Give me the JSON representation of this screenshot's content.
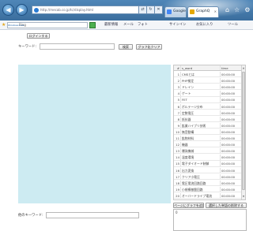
{
  "browser": {
    "address": "http://mecab.co.jp/tc/display.html",
    "tabs": [
      {
        "label": "Google"
      },
      {
        "label": "GraphQ"
      }
    ],
    "favbar": {
      "live_search_label": "Windows Live",
      "live_search_value": "Bing",
      "links": [
        "最新情報",
        "メール",
        "フォト",
        "サインイン",
        "お気に入り",
        "ツール"
      ],
      "favorites_label": "お気に入り"
    }
  },
  "page": {
    "top_button": "ログインする",
    "keyword_label": "キーワード:",
    "keyword_value": "",
    "search_button": "検索",
    "graph_button": "グラフ化クリア",
    "bottom_keyword_label": "他のキーワード:",
    "bottom_keyword_value": "",
    "add_button": "ページにグラフを追加",
    "remove_button": "選択した単語の削除する",
    "textarea_value": "0"
  },
  "table": {
    "headers": [
      "#",
      "s_word",
      "time"
    ],
    "rows": [
      {
        "no": "1",
        "word": "CMSとは",
        "time": "00:00:00"
      },
      {
        "no": "2",
        "word": "PHP検定",
        "time": "00:00:00"
      },
      {
        "no": "3",
        "word": "ドレイン",
        "time": "00:00:00"
      },
      {
        "no": "4",
        "word": "ゲート",
        "time": "00:00:00"
      },
      {
        "no": "5",
        "word": "FET",
        "time": "00:00:00"
      },
      {
        "no": "6",
        "word": "ボルテージ分布",
        "time": "00:00:00"
      },
      {
        "no": "7",
        "word": "定数電圧",
        "time": "00:00:00"
      },
      {
        "no": "8",
        "word": "抵抗器",
        "time": "00:00:00"
      },
      {
        "no": "9",
        "word": "鉱業ハイブリ技術",
        "time": "00:00:00"
      },
      {
        "no": "10",
        "word": "無音動構",
        "time": "00:00:00"
      },
      {
        "no": "11",
        "word": "鉱物材料",
        "time": "00:00:00"
      },
      {
        "no": "12",
        "word": "機器",
        "time": "00:00:00"
      },
      {
        "no": "13",
        "word": "爆発機械",
        "time": "00:00:00"
      },
      {
        "no": "14",
        "word": "温度環境",
        "time": "00:00:00"
      },
      {
        "no": "15",
        "word": "電子ダイオード制御",
        "time": "00:00:00"
      },
      {
        "no": "16",
        "word": "出力変換",
        "time": "00:00:00"
      },
      {
        "no": "17",
        "word": "クリア小電圧",
        "time": "00:00:00"
      },
      {
        "no": "18",
        "word": "電圧電流回路回路",
        "time": "00:00:00"
      },
      {
        "no": "19",
        "word": "小規模基盤回路",
        "time": "00:00:00"
      },
      {
        "no": "20",
        "word": "オーバードライブ電流",
        "time": "00:00:00"
      }
    ]
  },
  "colors": {
    "panel_bg": "#cdebf2",
    "chrome_blue": "#3b6e9e"
  }
}
